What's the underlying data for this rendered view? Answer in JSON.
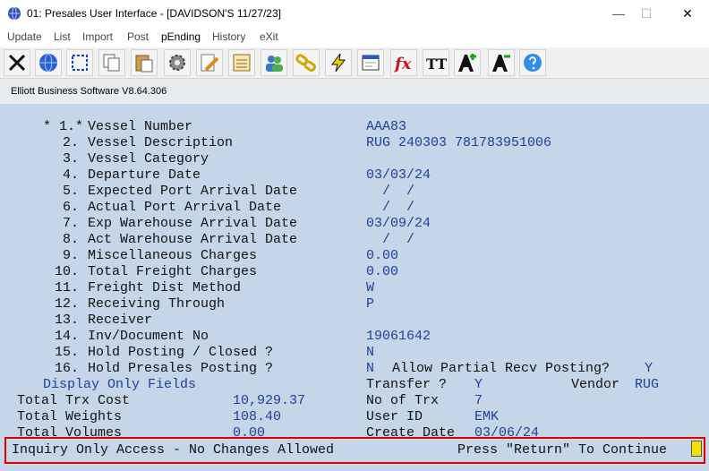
{
  "window": {
    "title": "01: Presales User Interface - [DAVIDSON'S 11/27/23]",
    "controls": {
      "minimize": "—",
      "maximize": "☐",
      "close": "✕"
    }
  },
  "menu": [
    "Update",
    "List",
    "Import",
    "Post",
    "pEnding",
    "History",
    "eXit"
  ],
  "toolbar": {
    "icons": [
      "close-x-icon",
      "globe-icon",
      "select-icon",
      "copy-icon",
      "paste-icon",
      "gear-icon",
      "edit-icon",
      "notes-icon",
      "users-icon",
      "link-icon",
      "lightning-icon",
      "window-icon",
      "function-icon",
      "text-format-icon",
      "font-larger-icon",
      "font-smaller-icon",
      "help-icon"
    ],
    "fx_label": "fx",
    "tt_label": "TT"
  },
  "subheader": {
    "title": "Elliott Business Software V8.64.306"
  },
  "fields": [
    {
      "mark": "* 1.*",
      "label": "Vessel Number",
      "value": "AAA83"
    },
    {
      "mark": "2.",
      "label": "Vessel Description",
      "value": "RUG 240303 781783951006"
    },
    {
      "mark": "3.",
      "label": "Vessel Category",
      "value": ""
    },
    {
      "mark": "4.",
      "label": "Departure Date",
      "value": "03/03/24"
    },
    {
      "mark": "5.",
      "label": "Expected Port Arrival Date",
      "value": "  /  /"
    },
    {
      "mark": "6.",
      "label": "Actual Port Arrival Date",
      "value": "  /  /"
    },
    {
      "mark": "7.",
      "label": "Exp Warehouse Arrival Date",
      "value": "03/09/24"
    },
    {
      "mark": "8.",
      "label": "Act Warehouse Arrival Date",
      "value": "  /  /"
    },
    {
      "mark": "9.",
      "label": "Miscellaneous Charges",
      "value": "0.00"
    },
    {
      "mark": "10.",
      "label": "Total Freight Charges",
      "value": "0.00"
    },
    {
      "mark": "11.",
      "label": "Freight Dist Method",
      "value": "W"
    },
    {
      "mark": "12.",
      "label": "Receiving Through",
      "value": "P"
    },
    {
      "mark": "13.",
      "label": "Receiver",
      "value": ""
    },
    {
      "mark": "14.",
      "label": "Inv/Document No",
      "value": "19061642"
    },
    {
      "mark": "15.",
      "label": "Hold Posting / Closed ?",
      "value": "N"
    },
    {
      "mark": "16.",
      "label": "Hold Presales Posting ?",
      "value": "N"
    }
  ],
  "allow_partial": {
    "label": "Allow Partial Recv Posting?",
    "value": "Y"
  },
  "display_only": {
    "label": "Display Only Fields"
  },
  "transfer": {
    "label": "Transfer ?",
    "value": "Y"
  },
  "vendor": {
    "label": "Vendor",
    "value": "RUG"
  },
  "totals": {
    "trx_cost": {
      "label": "Total Trx Cost",
      "value": "10,929.37"
    },
    "weights": {
      "label": "Total Weights",
      "value": "108.40"
    },
    "volumes": {
      "label": "Total Volumes",
      "value": "0.00"
    }
  },
  "no_of_trx": {
    "label": "No of Trx",
    "value": "7"
  },
  "user_id": {
    "label": "User ID",
    "value": "EMK"
  },
  "create_date": {
    "label": "Create Date",
    "value": "03/06/24"
  },
  "status": {
    "message": "Inquiry Only Access - No Changes Allowed",
    "prompt": "Press \"Return\" To Continue"
  }
}
